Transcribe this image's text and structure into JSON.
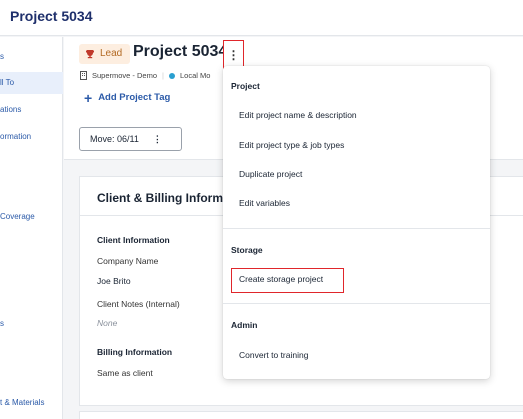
{
  "app": {
    "title": "Project 5034"
  },
  "sidebar": {
    "items": [
      {
        "label": "s"
      },
      {
        "label": "ll To"
      },
      {
        "label": "ations"
      },
      {
        "label": "ormation"
      },
      {
        "label": "Coverage"
      },
      {
        "label": "s"
      },
      {
        "label": "t & Materials"
      }
    ]
  },
  "header": {
    "badge": "Lead",
    "project_name": "Project 5034",
    "company": "Supermove - Demo",
    "location": "Local Mo",
    "add_tag": "Add Project Tag",
    "move_button": "Move: 06/11"
  },
  "card": {
    "title": "Client & Billing Informa",
    "client_info_label": "Client Information",
    "company_name_label": "Company Name",
    "company_name_value": "Joe Brito",
    "client_notes_label": "Client Notes (Internal)",
    "client_notes_value": "None",
    "billing_info_label": "Billing Information",
    "billing_value": "Same as client"
  },
  "menu": {
    "sections": [
      {
        "title": "Project",
        "items": [
          "Edit project name & description",
          "Edit project type & job types",
          "Duplicate project",
          "Edit variables"
        ]
      },
      {
        "title": "Storage",
        "items": [
          "Create storage project"
        ]
      },
      {
        "title": "Admin",
        "items": [
          "Convert to training"
        ]
      }
    ]
  },
  "colors": {
    "brand_blue": "#2b5aa8",
    "title_navy": "#1e2f6b",
    "highlight_red": "#e0262b",
    "lead_badge_bg": "#fdeee0"
  }
}
